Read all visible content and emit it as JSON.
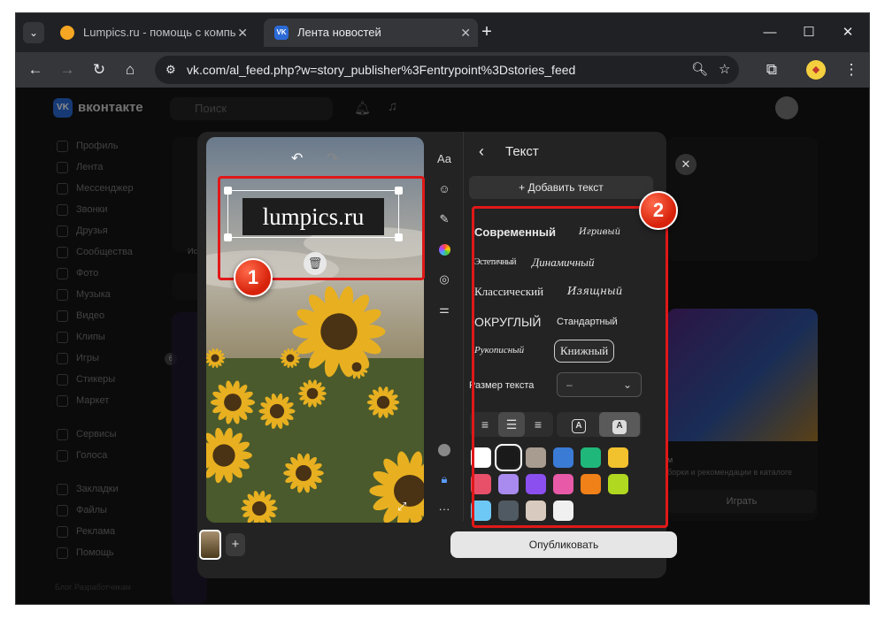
{
  "browser": {
    "tabs": [
      {
        "title": "Lumpics.ru - помощь с компь",
        "favicon_color": "#f5a623"
      },
      {
        "title": "Лента новостей",
        "favicon_color": "#2b6ad6",
        "favicon_text": "VK"
      }
    ],
    "url": "vk.com/al_feed.php?w=story_publisher%3Fentrypoint%3Dstories_feed"
  },
  "vk": {
    "logo": "VK",
    "name": "вконтакте",
    "search_placeholder": "Поиск",
    "sidebar": [
      "Профиль",
      "Лента",
      "Мессенджер",
      "Звонки",
      "Друзья",
      "Сообщества",
      "Фото",
      "Музыка",
      "Видео",
      "Клипы",
      "Игры",
      "Стикеры",
      "Маркет"
    ],
    "sidebar2": [
      "Сервисы",
      "Голоса"
    ],
    "sidebar3": [
      "Закладки",
      "Файлы",
      "Реклама",
      "Помощь"
    ],
    "footer": "Блог   Разработчикам",
    "games_badge": "6",
    "stories_label": "Исто",
    "catalog_text": "м",
    "catalog_sub": "борки и рекомендации в каталоге",
    "play_button": "Играть"
  },
  "editor": {
    "story_text": "lumpics.ru",
    "tools": [
      "Aa",
      "sticker",
      "brush",
      "color",
      "mask",
      "adjust"
    ],
    "panel_title": "Текст",
    "add_text": "Добавить текст",
    "fonts": [
      {
        "label": "Современный"
      },
      {
        "label": "Игривый"
      },
      {
        "label": "Эстетичный"
      },
      {
        "label": "Динамичный"
      },
      {
        "label": "Классический"
      },
      {
        "label": "Изящный"
      },
      {
        "label": "ОКРУГЛЫЙ"
      },
      {
        "label": "Стандартный"
      },
      {
        "label": "Рукописный"
      },
      {
        "label": "Книжный",
        "selected": true
      }
    ],
    "size_label": "Размер текста",
    "size_value": "–",
    "style_a": "A",
    "colors": [
      "#ffffff",
      "#1a1a1a",
      "#a89b90",
      "#3a7bd5",
      "#1fb87a",
      "#f2c12e",
      "#e8506a",
      "#a98bf0",
      "#8b4ff0",
      "#e85aa8",
      "#f08018",
      "#b0d820",
      "#6ec8f5",
      "#505a62",
      "#d8cabe",
      "#f0f0f0"
    ],
    "publish": "Опубликовать"
  },
  "annotations": {
    "badge1": "1",
    "badge2": "2",
    "highlight_color": "#e01818"
  }
}
